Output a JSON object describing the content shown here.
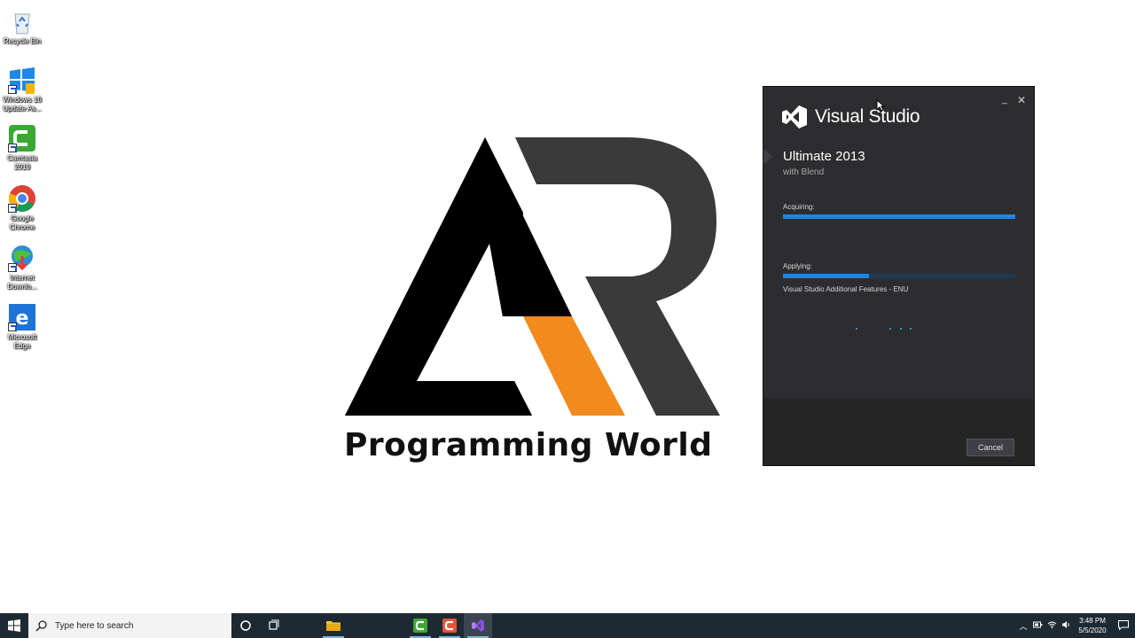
{
  "desktop": {
    "icons": [
      {
        "label": "Recycle Bin",
        "icon": "recycle-bin-icon"
      },
      {
        "label": "Windows 10 Update As...",
        "icon": "windows-update-icon"
      },
      {
        "label": "Camtasia 2019",
        "icon": "camtasia-icon"
      },
      {
        "label": "Google Chrome",
        "icon": "chrome-icon"
      },
      {
        "label": "Internet Downlo...",
        "icon": "internet-download-manager-icon"
      },
      {
        "label": "Microsoft Edge",
        "icon": "edge-icon"
      }
    ]
  },
  "wallpaper": {
    "logo_text": "Programming World",
    "colors": {
      "black": "#000000",
      "dark": "#3a3a3a",
      "orange": "#f28a1e"
    }
  },
  "installer": {
    "brand": "Visual Studio",
    "edition": "Ultimate 2013",
    "subtitle": "with Blend",
    "acquiring_label": "Acquiring:",
    "acquiring_progress": 1.0,
    "applying_label": "Applying:",
    "applying_progress": 0.37,
    "status": "Visual Studio Additional Features - ENU",
    "minimize_label": "_",
    "close_label": "✕",
    "cancel_label": "Cancel",
    "colors": {
      "bg": "#2d2d30",
      "accent": "#1c86e6"
    }
  },
  "taskbar": {
    "search_placeholder": "Type here to search",
    "apps": [
      {
        "icon": "cortana-icon"
      },
      {
        "icon": "task-view-icon"
      },
      {
        "icon": "file-explorer-icon"
      },
      {
        "icon": "camtasia-icon"
      },
      {
        "icon": "camtasia-recorder-icon"
      },
      {
        "icon": "visual-studio-icon"
      }
    ],
    "clock_time": "3:48 PM",
    "clock_date": "5/5/2020"
  }
}
